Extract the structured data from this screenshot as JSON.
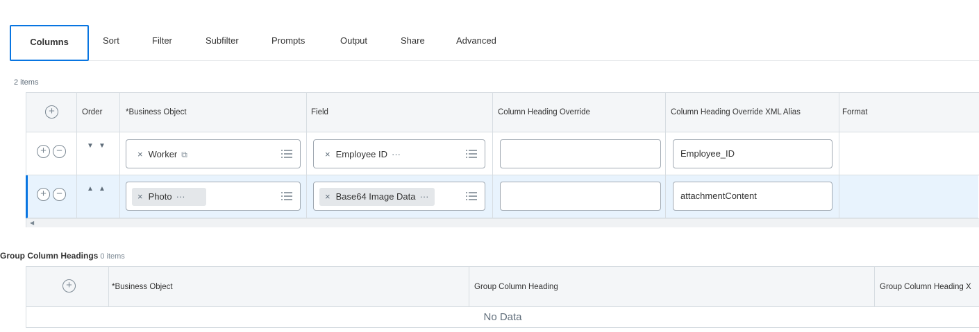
{
  "tabs": [
    "Columns",
    "Sort",
    "Filter",
    "Subfilter",
    "Prompts",
    "Output",
    "Share",
    "Advanced"
  ],
  "columns_table": {
    "count": "2 items",
    "headers": {
      "order": "Order",
      "business_object": "*Business Object",
      "field": "Field",
      "heading_override": "Column Heading Override",
      "xml_alias": "Column Heading Override XML Alias",
      "format": "Format"
    },
    "rows": [
      {
        "order_arrows": [
          "▼",
          "▼"
        ],
        "business_object": "Worker",
        "field": "Employee ID",
        "heading_override": "",
        "xml_alias": "Employee_ID"
      },
      {
        "order_arrows": [
          "▲",
          "▲"
        ],
        "business_object": "Photo",
        "field": "Base64 Image Data",
        "heading_override": "",
        "xml_alias": "attachmentContent"
      }
    ]
  },
  "group_table": {
    "title": "Group Column Headings",
    "count": "0 items",
    "headers": {
      "business_object": "*Business Object",
      "heading": "Group Column Heading",
      "xml_alias": "Group Column Heading X"
    },
    "empty_text": "No Data"
  },
  "icons": {
    "add": "plus-circle-icon",
    "remove": "minus-circle-icon",
    "clear": "x-icon",
    "more": "ellipsis-icon",
    "external": "external-link-icon",
    "list": "list-icon"
  },
  "colors": {
    "accent": "#0875e1",
    "selected_row": "#e8f3fd",
    "header_bg": "#f4f6f8"
  }
}
